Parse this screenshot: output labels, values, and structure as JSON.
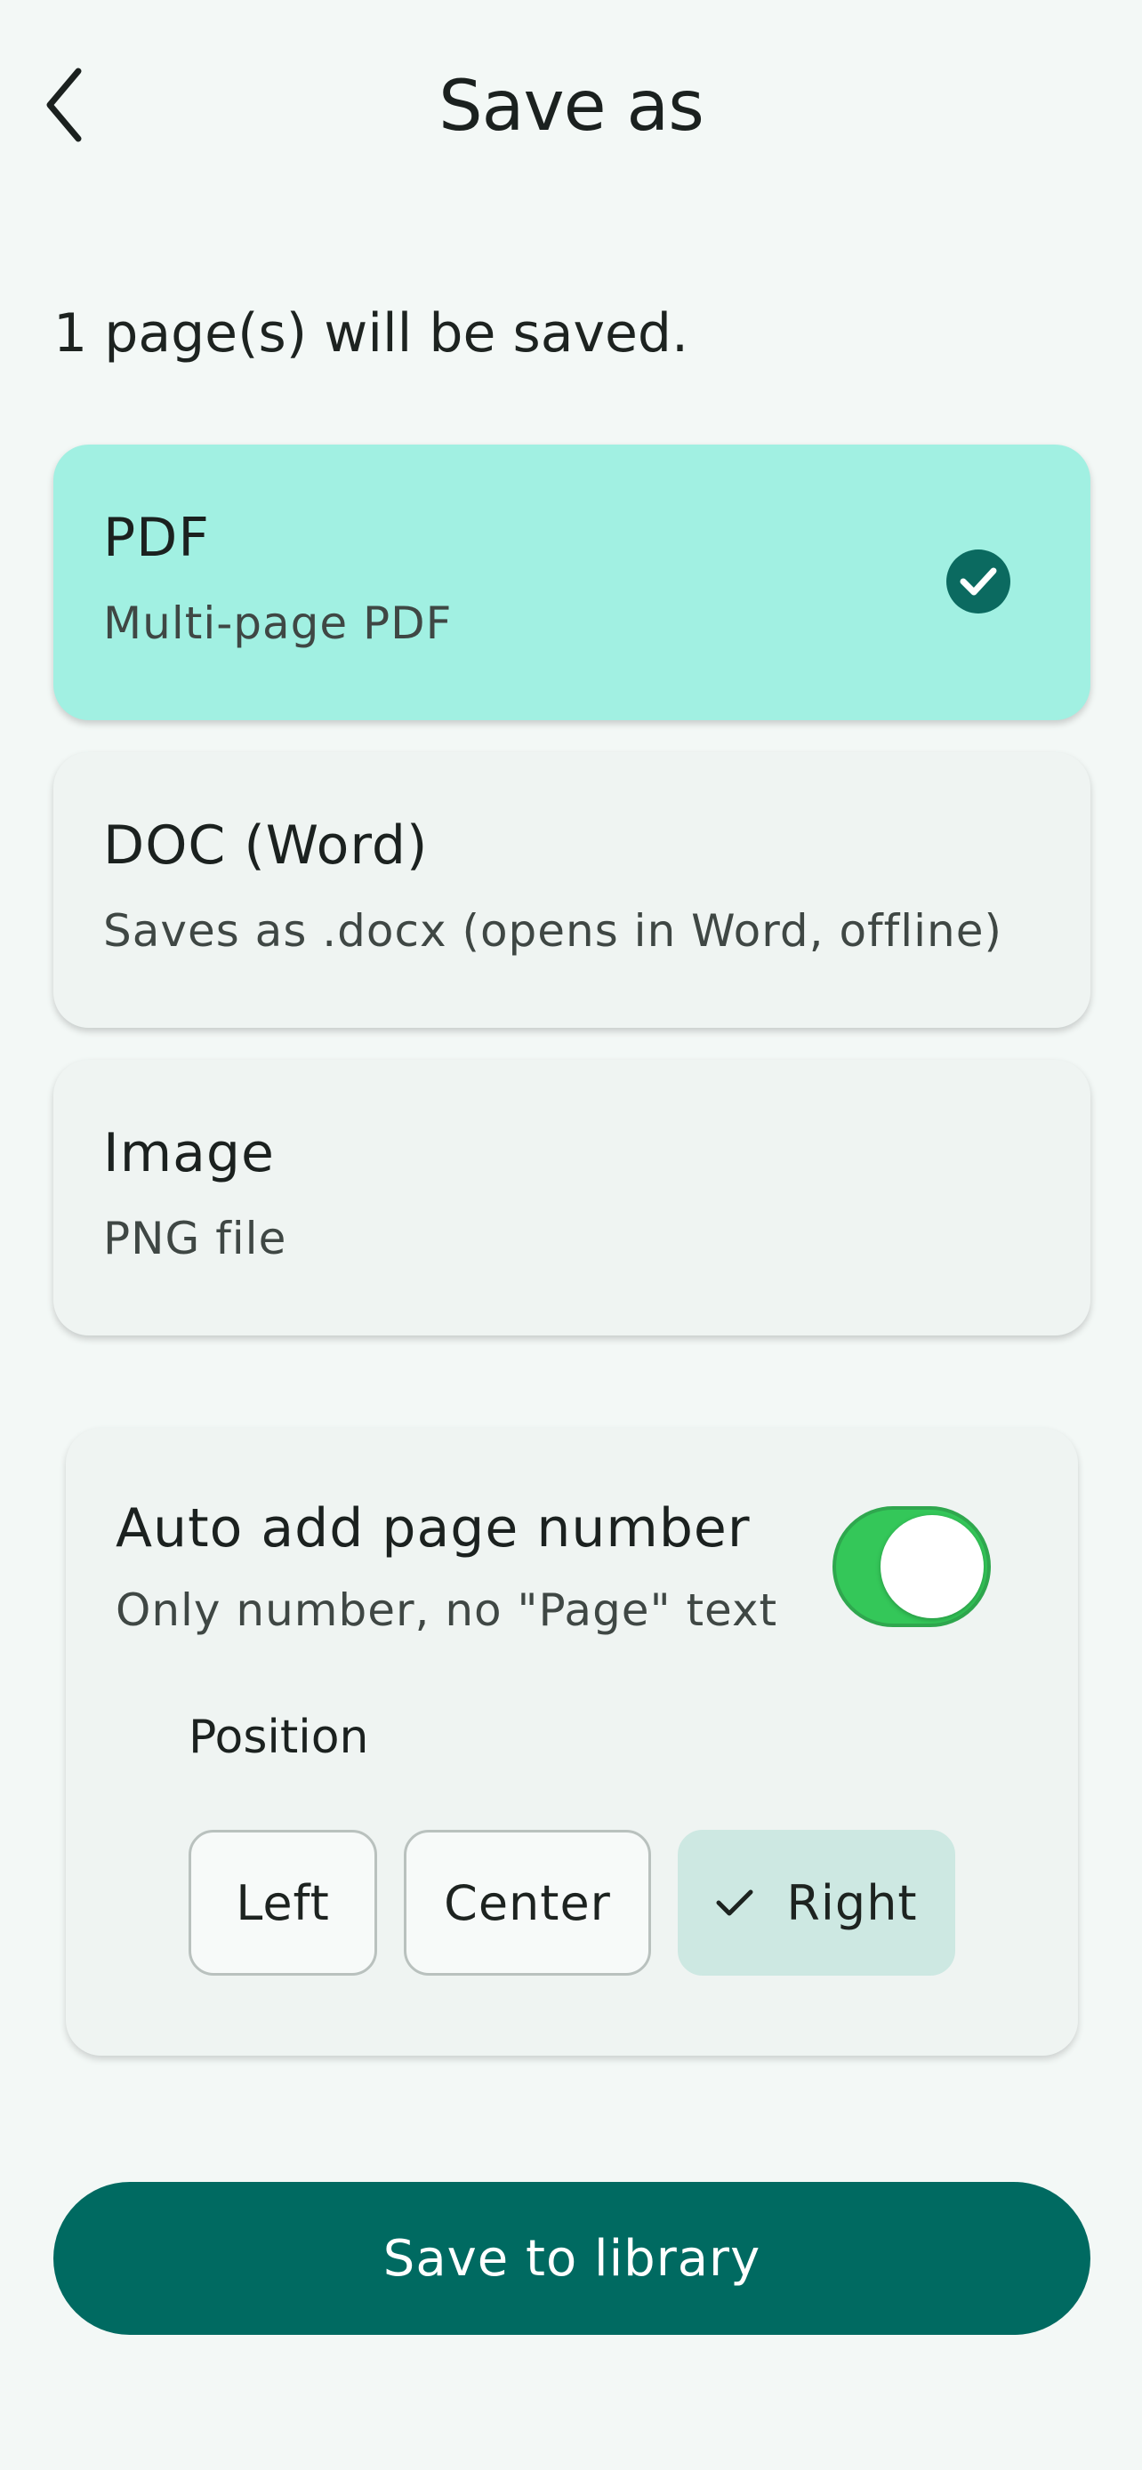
{
  "header": {
    "title": "Save as"
  },
  "summary": "1 page(s) will be saved.",
  "formats": [
    {
      "title": "PDF",
      "subtitle": "Multi-page PDF",
      "selected": true
    },
    {
      "title": "DOC (Word)",
      "subtitle": "Saves as .docx (opens in Word, offline)",
      "selected": false
    },
    {
      "title": "Image",
      "subtitle": "PNG file",
      "selected": false
    }
  ],
  "page_number": {
    "title": "Auto add page number",
    "subtitle": "Only number, no \"Page\" text",
    "enabled": true,
    "position_label": "Position",
    "positions": [
      "Left",
      "Center",
      "Right"
    ],
    "selected_position": "Right"
  },
  "save_button": "Save to library",
  "colors": {
    "background": "#f3f8f6",
    "selected_option": "#a1f0e2",
    "primary": "#006a61",
    "toggle_on": "#34c759",
    "position_active": "#cde8e2"
  },
  "icons": {
    "back": "chevron-left-icon",
    "selected": "check-circle-icon",
    "position_selected": "check-icon"
  }
}
